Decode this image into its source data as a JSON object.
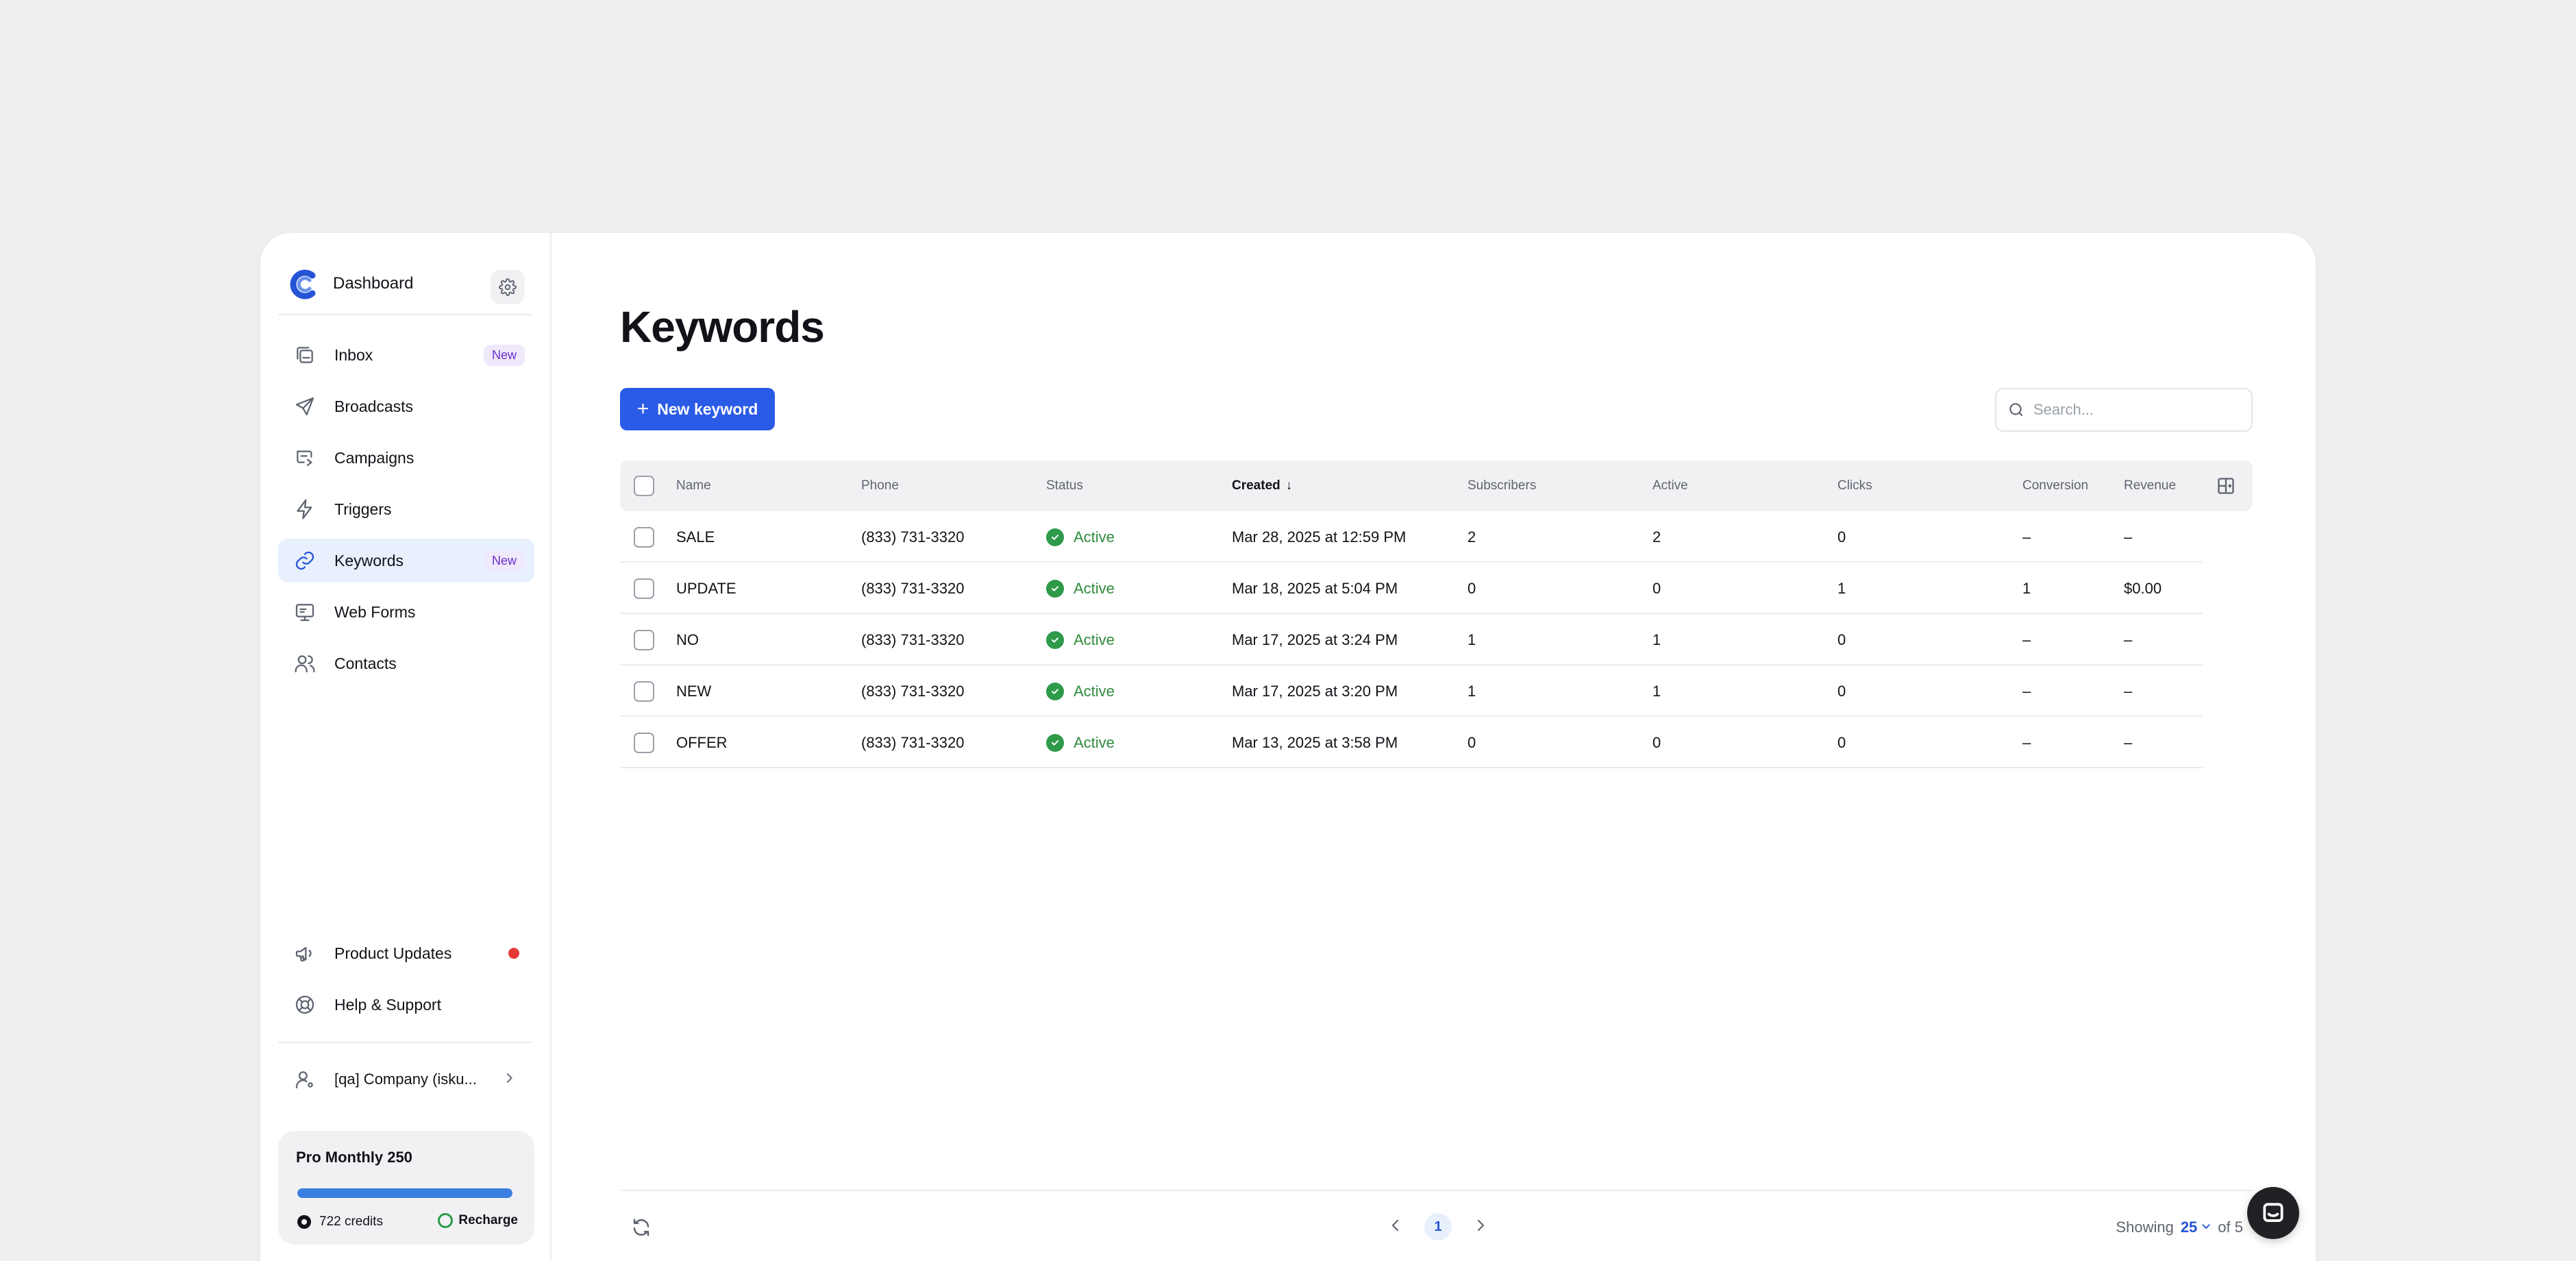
{
  "sidebar": {
    "dashboard_label": "Dashboard",
    "nav": [
      {
        "label": "Inbox",
        "badge": "New",
        "icon": "inbox-icon"
      },
      {
        "label": "Broadcasts",
        "badge": "",
        "icon": "paper-plane-icon"
      },
      {
        "label": "Campaigns",
        "badge": "",
        "icon": "campaign-icon"
      },
      {
        "label": "Triggers",
        "badge": "",
        "icon": "lightning-icon"
      },
      {
        "label": "Keywords",
        "badge": "New",
        "icon": "link-icon",
        "active": true
      },
      {
        "label": "Web Forms",
        "badge": "",
        "icon": "monitor-icon"
      },
      {
        "label": "Contacts",
        "badge": "",
        "icon": "users-icon"
      }
    ],
    "product_updates_label": "Product Updates",
    "help_label": "Help & Support",
    "company_label": "[qa] Company (isku...",
    "plan": {
      "name": "Pro Monthly 250",
      "progress": 1.0,
      "credits": "722 credits",
      "recharge": "Recharge"
    }
  },
  "main": {
    "title": "Keywords",
    "new_button": "New keyword",
    "search_placeholder": "Search...",
    "columns": {
      "name": "Name",
      "phone": "Phone",
      "status": "Status",
      "created": "Created",
      "subscribers": "Subscribers",
      "active": "Active",
      "clicks": "Clicks",
      "conversion": "Conversion",
      "revenue": "Revenue"
    },
    "sort_arrow": "↓",
    "rows": [
      {
        "name": "SALE",
        "phone": "(833) 731-3320",
        "status": "Active",
        "created": "Mar 28, 2025 at 12:59 PM",
        "subscribers": "2",
        "active": "2",
        "clicks": "0",
        "conversion": "–",
        "revenue": "–"
      },
      {
        "name": "UPDATE",
        "phone": "(833) 731-3320",
        "status": "Active",
        "created": "Mar 18, 2025 at 5:04 PM",
        "subscribers": "0",
        "active": "0",
        "clicks": "1",
        "conversion": "1",
        "revenue": "$0.00"
      },
      {
        "name": "NO",
        "phone": "(833) 731-3320",
        "status": "Active",
        "created": "Mar 17, 2025 at 3:24 PM",
        "subscribers": "1",
        "active": "1",
        "clicks": "0",
        "conversion": "–",
        "revenue": "–"
      },
      {
        "name": "NEW",
        "phone": "(833) 731-3320",
        "status": "Active",
        "created": "Mar 17, 2025 at 3:20 PM",
        "subscribers": "1",
        "active": "1",
        "clicks": "0",
        "conversion": "–",
        "revenue": "–"
      },
      {
        "name": "OFFER",
        "phone": "(833) 731-3320",
        "status": "Active",
        "created": "Mar 13, 2025 at 3:58 PM",
        "subscribers": "0",
        "active": "0",
        "clicks": "0",
        "conversion": "–",
        "revenue": "–"
      }
    ],
    "pagination": {
      "current_page": "1",
      "showing_label": "Showing",
      "per_page": "25",
      "of_label": "of 5"
    }
  },
  "colors": {
    "accent": "#2a5be6",
    "active_status": "#2e8b3d",
    "badge_text": "#6b2fd0",
    "notification_dot": "#e53935"
  }
}
